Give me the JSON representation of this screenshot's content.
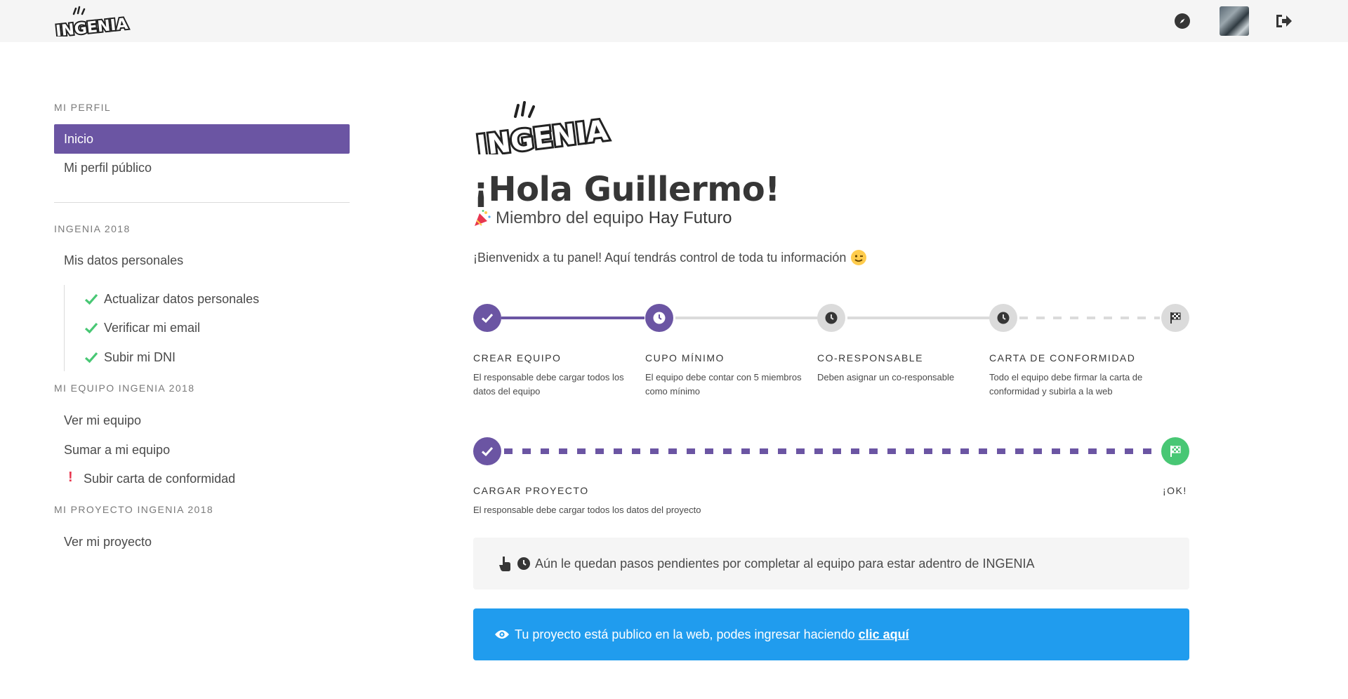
{
  "brand": {
    "name": "INGENIA"
  },
  "navbar": {
    "icons": [
      "compass-icon",
      "avatar",
      "sign-out-icon"
    ]
  },
  "sidebar": {
    "section1": {
      "label": "MI PERFIL",
      "items": [
        {
          "label": "Inicio",
          "active": true
        },
        {
          "label": "Mi perfil público"
        }
      ]
    },
    "section2": {
      "label": "INGENIA 2018",
      "item": "Mis datos personales",
      "subitems": [
        {
          "label": "Actualizar datos personales",
          "status": "done"
        },
        {
          "label": "Verificar mi email",
          "status": "done"
        },
        {
          "label": "Subir mi DNI",
          "status": "done"
        }
      ]
    },
    "section3": {
      "label": "MI EQUIPO INGENIA 2018",
      "items": [
        {
          "label": "Ver mi equipo"
        },
        {
          "label": "Sumar a mi equipo"
        },
        {
          "label": "Subir carta de conformidad",
          "alert": "!"
        }
      ]
    },
    "section4": {
      "label": "MI PROYECTO INGENIA 2018",
      "items": [
        {
          "label": "Ver mi proyecto"
        }
      ]
    }
  },
  "main": {
    "greeting": "¡Hola Guillermo!",
    "subtitle_prefix": "Miembro del equipo",
    "team_name": "Hay Futuro",
    "welcome": "¡Bienvenidx a tu panel! Aquí tendrás control de toda tu información",
    "steps_row1": [
      {
        "title": "CREAR EQUIPO",
        "desc": "El responsable debe cargar todos los datos del equipo",
        "state": "done"
      },
      {
        "title": "CUPO MÍNIMO",
        "desc": "El equipo debe contar con 5 miembros como mínimo",
        "state": "pending-current"
      },
      {
        "title": "CO-RESPONSABLE",
        "desc": "Deben asignar un co-responsable",
        "state": "pending"
      },
      {
        "title": "CARTA DE CONFORMIDAD",
        "desc": "Todo el equipo debe firmar la carta de conformidad y subirla a la web",
        "state": "pending"
      }
    ],
    "steps_row2": [
      {
        "title": "CARGAR PROYECTO",
        "desc": "El responsable debe cargar todos los datos del proyecto",
        "state": "done"
      },
      {
        "title": "¡OK!",
        "state": "finish"
      }
    ],
    "notice": "Aún le quedan pasos pendientes por completar al equipo para estar adentro de INGENIA",
    "info": {
      "text": "Tu proyecto está publico en la web, podes ingresar haciendo",
      "link": "clic aquí"
    }
  },
  "colors": {
    "primary": "#6b55a3",
    "info": "#209cee",
    "success": "#48c774",
    "navbar": "#f5f5f5"
  }
}
